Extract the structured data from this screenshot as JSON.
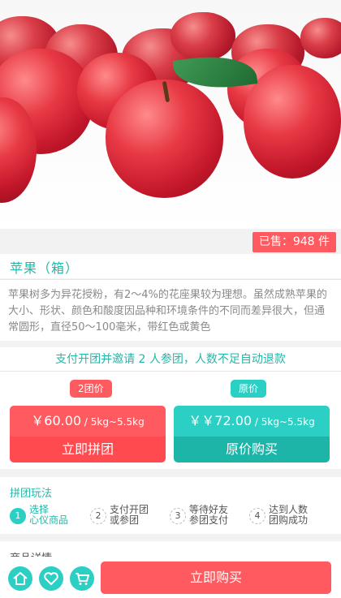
{
  "product": {
    "sold_label": "已售：948 件",
    "title": "苹果（箱）",
    "description": "苹果树多为异花授粉，有2～4%的花座果较为理想。虽然成熟苹果的大小、形状、颜色和酸度因品种和环境条件的不同而差异很大，但通常圆形，直径50～100毫米，带红色或黄色"
  },
  "group": {
    "tip": "支付开团并邀请 2 人参团，人数不足自动退款",
    "group_tag": "2团价",
    "origin_tag": "原价",
    "group_price": "￥60.00",
    "group_spec": " / 5kg~5.5kg",
    "group_button": "立即拼团",
    "origin_price": "￥￥72.00",
    "origin_spec": " / 5kg~5.5kg",
    "origin_button": "原价购买"
  },
  "play": {
    "title": "拼团玩法",
    "steps": [
      {
        "num": "1",
        "line1": "选择",
        "line2": "心仪商品"
      },
      {
        "num": "2",
        "line1": "支付开团",
        "line2": "或参团"
      },
      {
        "num": "3",
        "line1": "等待好友",
        "line2": "参团支付"
      },
      {
        "num": "4",
        "line1": "达到人数",
        "line2": "团购成功"
      }
    ]
  },
  "detail": {
    "title": "商品详情"
  },
  "bottom": {
    "icons": [
      "home-icon",
      "heart-icon",
      "cart-icon"
    ],
    "buy_button": "立即购买"
  },
  "colors": {
    "accent": "#2ccfc4",
    "accent_text": "#23b7a8",
    "red": "#ff5a5f"
  }
}
